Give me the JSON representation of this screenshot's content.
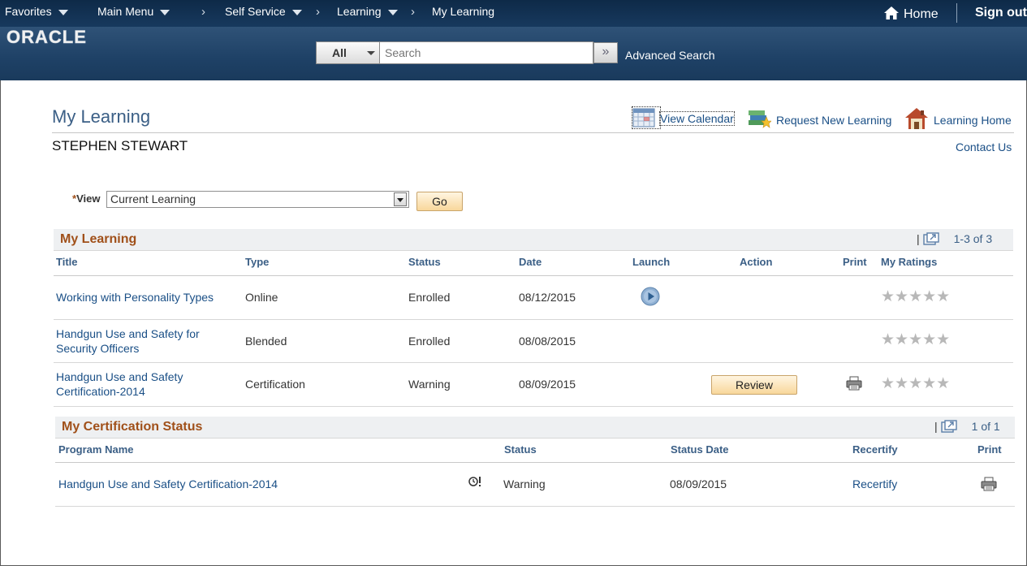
{
  "nav": {
    "favorites": "Favorites",
    "main_menu": "Main Menu",
    "self_service": "Self Service",
    "learning": "Learning",
    "my_learning": "My Learning",
    "home": "Home",
    "sign_out": "Sign out"
  },
  "brand": {
    "logo": "ORACLE"
  },
  "search": {
    "scope": "All",
    "placeholder": "Search",
    "go_icon": "double-chevron-right-icon",
    "advanced": "Advanced Search"
  },
  "page": {
    "title": "My Learning",
    "person": "STEPHEN STEWART",
    "links": {
      "view_calendar": "View Calendar",
      "request_new_learning": "Request New Learning",
      "learning_home": "Learning Home",
      "contact_us": "Contact Us"
    }
  },
  "view": {
    "required_mark": "*",
    "label": "View",
    "selected": "Current Learning",
    "go": "Go"
  },
  "my_learning_grid": {
    "title": "My Learning",
    "pager": "1-3 of 3",
    "columns": {
      "title": "Title",
      "type": "Type",
      "status": "Status",
      "date": "Date",
      "launch": "Launch",
      "action": "Action",
      "print": "Print",
      "ratings": "My Ratings"
    },
    "rows": [
      {
        "title_line1": "Working with Personality Types",
        "title_line2": "",
        "type": "Online",
        "status": "Enrolled",
        "date": "08/12/2015",
        "rating": 0
      },
      {
        "title_line1": "Handgun Use and Safety for",
        "title_line2": "Security Officers",
        "type": "Blended",
        "status": "Enrolled",
        "date": "08/08/2015",
        "rating": 0
      },
      {
        "title_line1": "Handgun Use and Safety",
        "title_line2": "Certification-2014",
        "type": "Certification",
        "status": "Warning",
        "date": "08/09/2015",
        "action": "Review",
        "rating": 0
      }
    ]
  },
  "cert_grid": {
    "title": "My Certification Status",
    "pager": "1 of 1",
    "columns": {
      "program": "Program Name",
      "status": "Status",
      "status_date": "Status Date",
      "recertify": "Recertify",
      "print": "Print"
    },
    "rows": [
      {
        "program": "Handgun Use and Safety Certification-2014",
        "status": "Warning",
        "status_date": "08/09/2015",
        "recertify": "Recertify"
      }
    ]
  },
  "colors": {
    "nav_bg": "#0e2a48",
    "banner_bg": "#1e4166",
    "title_blue": "#3b5f86",
    "link_blue": "#1a4f86",
    "section_orange": "#a0501a",
    "button_fill": "#f8d79b"
  }
}
